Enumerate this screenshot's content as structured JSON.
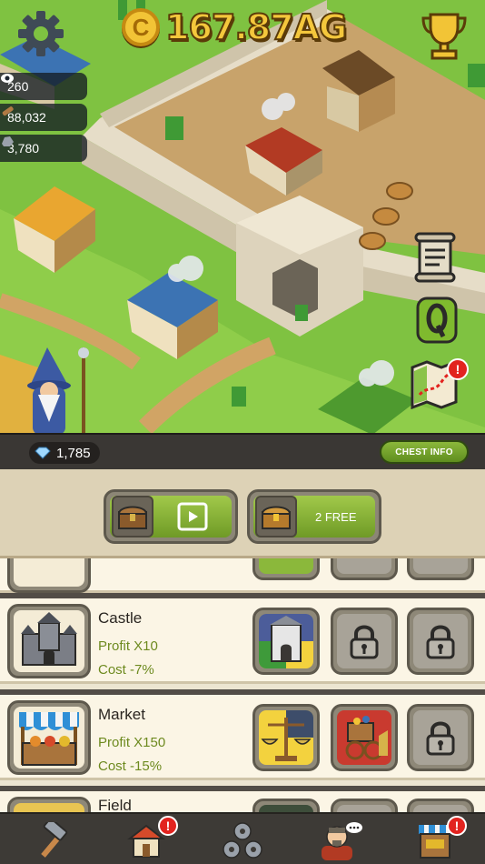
{
  "hud": {
    "gold": "167.87AG",
    "coin_symbol": "C",
    "views": "260",
    "wood": "88,032",
    "stone": "3,780"
  },
  "strip": {
    "gems": "1,785",
    "chest_info_label": "CHEST INFO"
  },
  "chest_panel": {
    "free_label": "2 FREE"
  },
  "buildings": [
    {
      "name": "Castle",
      "profit": "Profit X10",
      "cost": "Cost -7%",
      "slots": [
        "castle-hall-card",
        "locked",
        "locked"
      ]
    },
    {
      "name": "Market",
      "profit": "Profit X150",
      "cost": "Cost -15%",
      "slots": [
        "scales-card",
        "treasure-cart-card",
        "locked"
      ]
    },
    {
      "name": "Field",
      "profit": "",
      "cost": "",
      "slots": [
        "card",
        "card",
        "card"
      ]
    }
  ],
  "nav": {
    "items": [
      "hammer-icon",
      "house-icon",
      "gears-icon",
      "advisor-icon",
      "shop-icon"
    ],
    "badges": {
      "house": "!",
      "shop": "!"
    }
  },
  "map_badge": "!",
  "colors": {
    "grass": "#7fc241",
    "wall": "#d9cfb8",
    "dirt": "#c8a36b",
    "button_green": "#8bb83b",
    "profit_green": "#6d8a1f",
    "badge_red": "#e2231f",
    "gold": "#f4c73c"
  }
}
